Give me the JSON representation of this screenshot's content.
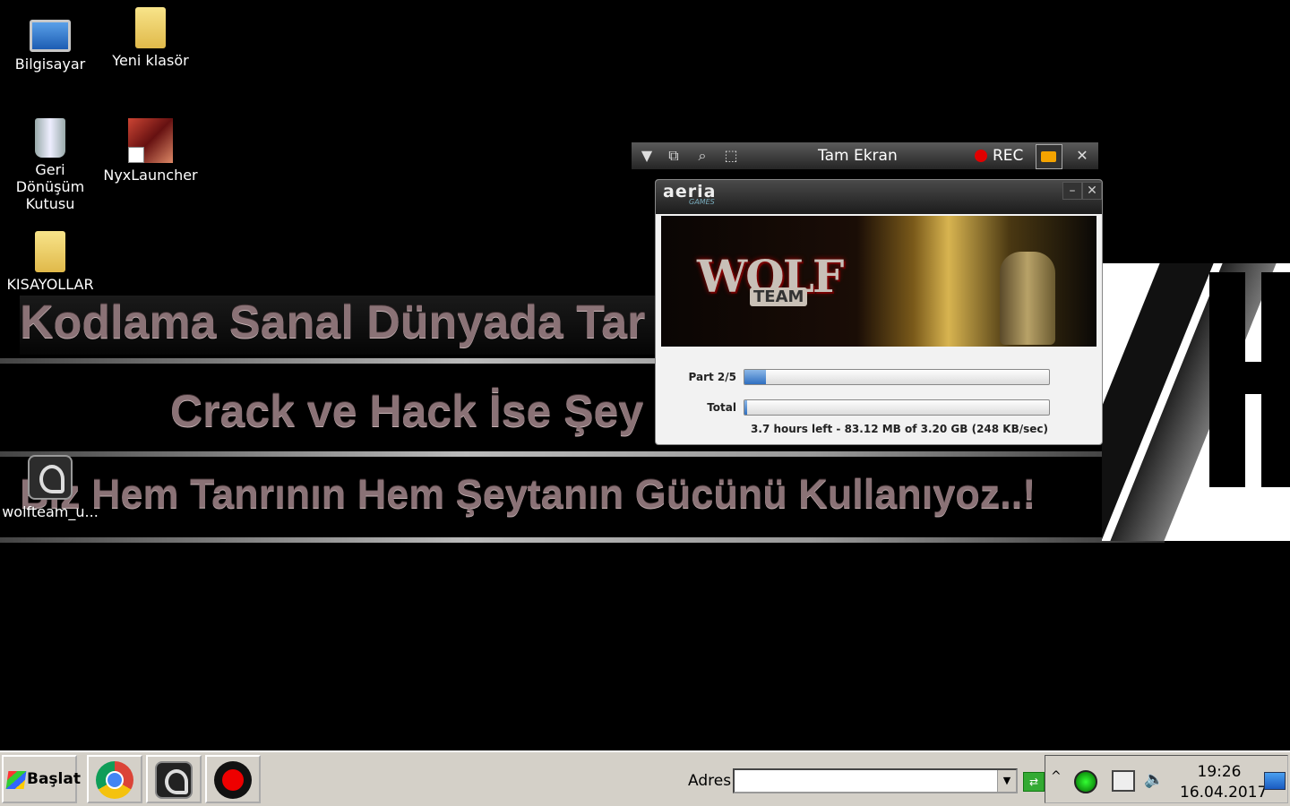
{
  "wallpaper": {
    "line1": "Kodlama Sanal Dünyada Tar",
    "line2": "Crack ve Hack İse Şey",
    "line3": "Biz Hem Tanrının Hem Şeytanın Gücünü Kullanıyoz..!"
  },
  "desktop": {
    "icons": [
      {
        "label": "Bilgisayar",
        "icon": "computer-icon"
      },
      {
        "label": "Yeni klasör",
        "icon": "folder-icon"
      },
      {
        "label": "Geri Dönüşüm Kutusu",
        "icon": "recycle-bin-icon"
      },
      {
        "label": "NyxLauncher",
        "icon": "nyxlauncher-icon"
      },
      {
        "label": "KISAYOLLAR",
        "icon": "folder-icon"
      },
      {
        "label": "wolfteam_u...",
        "icon": "aeria-installer-icon"
      }
    ]
  },
  "capture_toolbar": {
    "title": "Tam Ekran",
    "rec_label": "REC",
    "rec_color": "#e00000",
    "buttons": [
      "dropdown-icon",
      "windows-icon",
      "magnify-icon",
      "region-icon",
      "camera-icon",
      "close-icon"
    ]
  },
  "launcher": {
    "brand": "aeria",
    "brand_sub": "GAMES",
    "banner_title": "WOLF",
    "banner_subtitle": "TEAM",
    "part_label": "Part 2/5",
    "part_progress": 0.07,
    "total_label": "Total",
    "total_progress": 0.01,
    "status_text": "3.7 hours left - 83.12 MB of 3.20 GB (248 KB/sec)",
    "minimize": "–",
    "close": "✕"
  },
  "taskbar": {
    "start_label": "Başlat",
    "apps": [
      "chrome-icon",
      "aeria-icon",
      "recorder-icon"
    ],
    "address_label": "Adres",
    "address_value": "",
    "time": "19:26",
    "date": "16.04.2017"
  }
}
